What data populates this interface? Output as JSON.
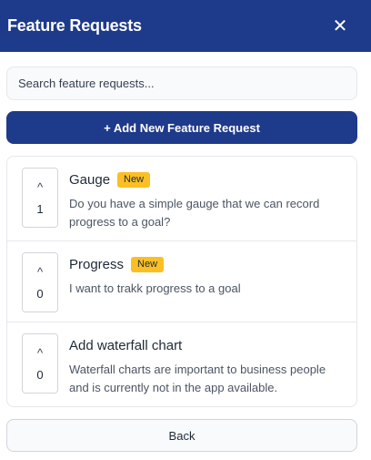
{
  "header": {
    "title": "Feature Requests",
    "close_icon": "close-icon",
    "close_glyph": "✕"
  },
  "search": {
    "placeholder": "Search feature requests..."
  },
  "actions": {
    "add_label": "+ Add New Feature Request",
    "back_label": "Back"
  },
  "requests": [
    {
      "upvote_glyph": "^",
      "votes": "1",
      "title": "Gauge",
      "badge": "New",
      "description": "Do you have a simple gauge that we can record progress to a goal?"
    },
    {
      "upvote_glyph": "^",
      "votes": "0",
      "title": "Progress",
      "badge": "New",
      "description": "I want to trakk progress to a goal"
    },
    {
      "upvote_glyph": "^",
      "votes": "0",
      "title": "Add waterfall chart",
      "badge": "",
      "description": "Waterfall charts are important to business people and is currently not in the app available."
    }
  ],
  "colors": {
    "primary": "#1e3a8a",
    "badge": "#fbbf24",
    "border": "#e5e7eb"
  }
}
